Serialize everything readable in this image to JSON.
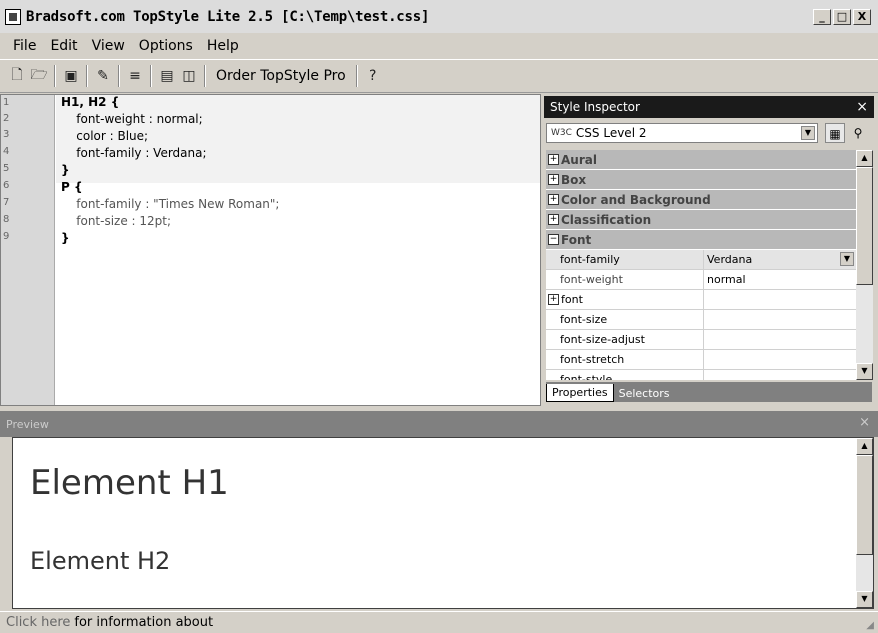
{
  "window": {
    "title": "Bradsoft.com TopStyle Lite 2.5 [C:\\Temp\\test.css]",
    "controls": [
      "_",
      "□",
      "X"
    ]
  },
  "menu": [
    "File",
    "Edit",
    "View",
    "Options",
    "Help"
  ],
  "toolbar": {
    "order_label": "Order TopStyle Pro"
  },
  "editor": {
    "line_numbers": [
      "1",
      "2",
      "3",
      "4",
      "5",
      "6",
      "7",
      "8",
      "9"
    ],
    "lines": [
      "H1, H2 {",
      "    font-weight : normal;",
      "    color : Blue;",
      "    font-family : Verdana;",
      "}",
      "P {",
      "    font-family : \"Times New Roman\";",
      "    font-size : 12pt;",
      "}"
    ]
  },
  "inspector": {
    "title": "Style Inspector",
    "close": "×",
    "level": "CSS Level 2",
    "categories": [
      "Aural",
      "Box",
      "Color and Background",
      "Classification",
      "Font"
    ],
    "properties": [
      {
        "name": "font-family",
        "value": "Verdana"
      },
      {
        "name": "font-weight",
        "value": "normal"
      },
      {
        "name": "font",
        "value": ""
      },
      {
        "name": "font-size",
        "value": ""
      },
      {
        "name": "font-size-adjust",
        "value": ""
      },
      {
        "name": "font-stretch",
        "value": ""
      },
      {
        "name": "font-style",
        "value": ""
      }
    ],
    "tabs": [
      "Properties",
      "Selectors"
    ]
  },
  "preview": {
    "title": "Preview",
    "close": "×",
    "h1": "Element H1",
    "h2": "Element H2"
  },
  "status": {
    "link": "Click here",
    "text": "for information about"
  }
}
